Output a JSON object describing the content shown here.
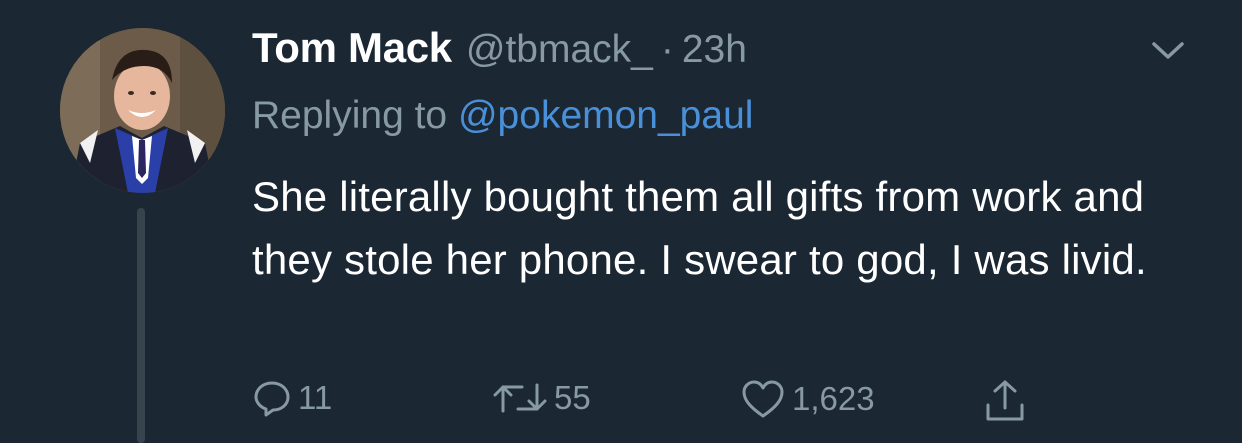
{
  "tweet": {
    "author_name": "Tom Mack",
    "author_handle": "@tbmack_",
    "separator": "·",
    "timestamp": "23h",
    "replying_prefix": "Replying to",
    "replying_to": "@pokemon_paul",
    "text": "She literally bought them all gifts from work and they stole her phone. I swear to god, I was livid.",
    "counts": {
      "replies": "11",
      "retweets": "55",
      "likes": "1,623"
    }
  },
  "colors": {
    "background": "#1b2733",
    "secondary_text": "#8899a6",
    "link": "#4a90d9",
    "thread_line": "#38444d"
  },
  "icons": {
    "reply": "speech-bubble-icon",
    "retweet": "retweet-arrows-icon",
    "like": "heart-icon",
    "share": "share-upload-icon",
    "menu": "chevron-down-icon"
  }
}
